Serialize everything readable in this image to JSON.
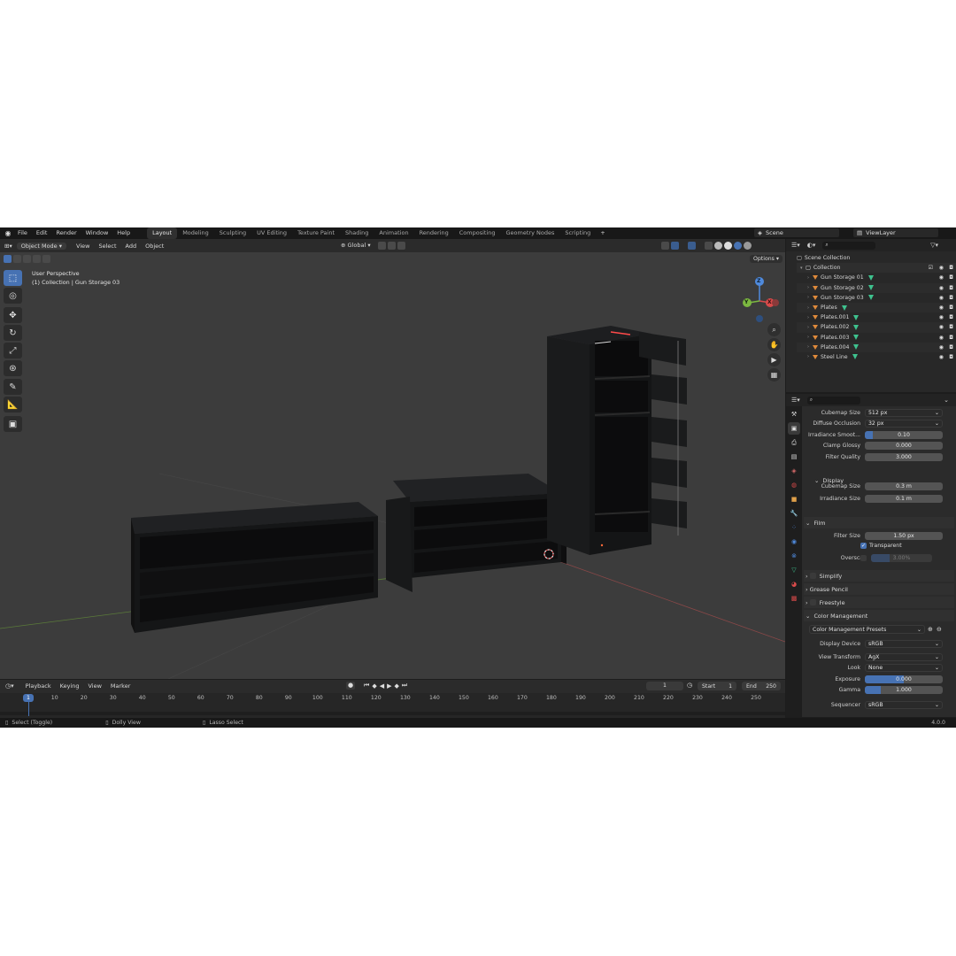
{
  "topbar": {
    "menus": [
      "File",
      "Edit",
      "Render",
      "Window",
      "Help"
    ],
    "workspaces": [
      "Layout",
      "Modeling",
      "Sculpting",
      "UV Editing",
      "Texture Paint",
      "Shading",
      "Animation",
      "Rendering",
      "Compositing",
      "Geometry Nodes",
      "Scripting"
    ],
    "active_workspace": "Layout",
    "add_tab": "+",
    "scene": "Scene",
    "view_layer": "ViewLayer"
  },
  "viewport": {
    "mode": "Object Mode",
    "menus": [
      "View",
      "Select",
      "Add",
      "Object"
    ],
    "orientation": "Global",
    "options": "Options",
    "overlay_title": "User Perspective",
    "overlay_sub": "(1) Collection | Gun Storage 03",
    "gizmo": {
      "x": "X",
      "y": "Y",
      "z": "Z"
    }
  },
  "outliner": {
    "root": "Scene Collection",
    "collection": "Collection",
    "items": [
      "Gun Storage 01",
      "Gun Storage 02",
      "Gun Storage 03",
      "Plates",
      "Plates.001",
      "Plates.002",
      "Plates.003",
      "Plates.004",
      "Steel Line"
    ]
  },
  "properties": {
    "rows": [
      {
        "label": "Cubemap Size",
        "value": "512 px",
        "kind": "drop"
      },
      {
        "label": "Diffuse Occlusion",
        "value": "32 px",
        "kind": "drop"
      },
      {
        "label": "Irradiance Smoot...",
        "value": "0.10",
        "kind": "slider",
        "fill": 0.1
      },
      {
        "label": "Clamp Glossy",
        "value": "0.000",
        "kind": "num"
      },
      {
        "label": "Filter Quality",
        "value": "3.000",
        "kind": "num"
      }
    ],
    "display_header": "Display",
    "display_rows": [
      {
        "label": "Cubemap Size",
        "value": "0.3 m"
      },
      {
        "label": "Irradiance Size",
        "value": "0.1 m"
      }
    ],
    "film_header": "Film",
    "filter_size_label": "Filter Size",
    "filter_size": "1.50 px",
    "transparent": "Transparent",
    "overscan_label": "Overscan",
    "overscan": "3.00%",
    "overscan_fill": 0.3,
    "simplify": "Simplify",
    "grease_pencil": "Grease Pencil",
    "freestyle": "Freestyle",
    "color_mgmt_header": "Color Management",
    "presets": "Color Management Presets",
    "cm_rows": [
      {
        "label": "Display Device",
        "value": "sRGB",
        "kind": "drop"
      },
      {
        "label": "View Transform",
        "value": "AgX",
        "kind": "drop"
      },
      {
        "label": "Look",
        "value": "None",
        "kind": "drop"
      },
      {
        "label": "Exposure",
        "value": "0.000",
        "kind": "slider",
        "fill": 0.5
      },
      {
        "label": "Gamma",
        "value": "1.000",
        "kind": "slider",
        "fill": 0.2
      },
      {
        "label": "Sequencer",
        "value": "sRGB",
        "kind": "drop"
      }
    ]
  },
  "timeline": {
    "menus": [
      "Playback",
      "Keying",
      "View",
      "Marker"
    ],
    "current_frame": "1",
    "start_label": "Start",
    "start": "1",
    "end_label": "End",
    "end": "250",
    "ticks": [
      "1",
      "10",
      "20",
      "30",
      "40",
      "50",
      "60",
      "70",
      "80",
      "90",
      "100",
      "110",
      "120",
      "130",
      "140",
      "150",
      "160",
      "170",
      "180",
      "190",
      "200",
      "210",
      "220",
      "230",
      "240",
      "250"
    ]
  },
  "status": {
    "select": "Select (Toggle)",
    "dolly": "Dolly View",
    "lasso": "Lasso Select",
    "version": "4.0.0"
  },
  "colors": {
    "accent": "#4772b3",
    "viewport_bg": "#3c3c3c",
    "panel_bg": "#2b2b2b",
    "mesh_icon": "#e08a3a",
    "modifier_icon": "#3ec28e"
  },
  "icons": [
    "blender-logo-icon",
    "select-box-icon",
    "cursor-icon",
    "move-icon",
    "rotate-icon",
    "scale-icon",
    "transform-icon",
    "annotate-icon",
    "measure-icon",
    "add-cube-icon",
    "zoom-icon",
    "hand-icon",
    "camera-icon",
    "grid-icon",
    "eye-icon",
    "camera-render-icon"
  ]
}
